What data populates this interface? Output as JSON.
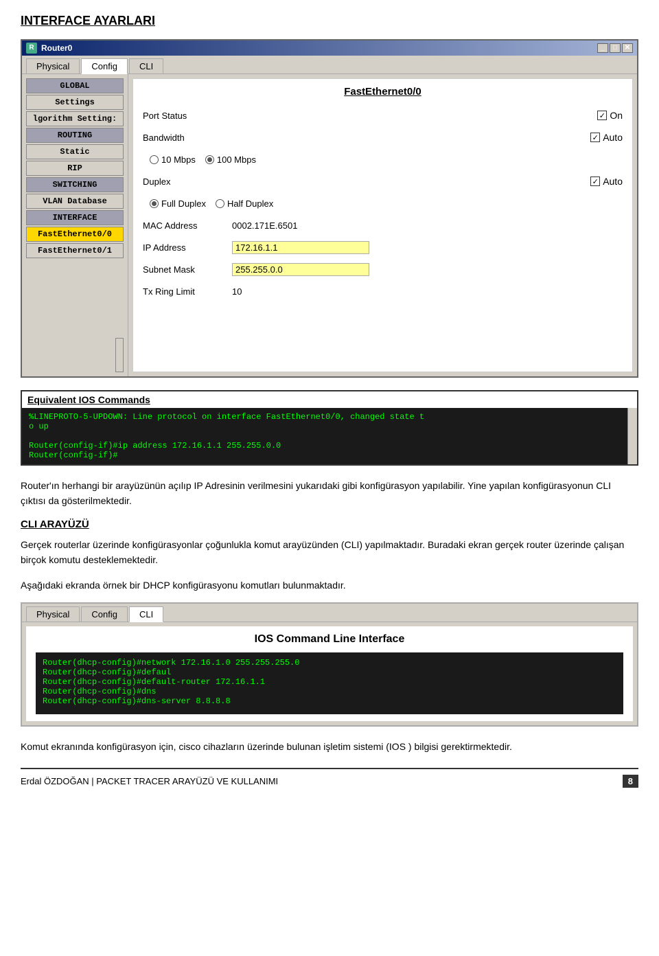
{
  "page": {
    "heading": "INTERFACE AYARLARI"
  },
  "router_window": {
    "title": "Router0",
    "tabs": [
      "Physical",
      "Config",
      "CLI"
    ],
    "active_tab": "Config",
    "sidebar": {
      "items": [
        {
          "label": "GLOBAL",
          "type": "section-header"
        },
        {
          "label": "Settings",
          "type": "normal"
        },
        {
          "label": "lgorithm Setting:",
          "type": "normal"
        },
        {
          "label": "ROUTING",
          "type": "section-header"
        },
        {
          "label": "Static",
          "type": "normal"
        },
        {
          "label": "RIP",
          "type": "normal"
        },
        {
          "label": "SWITCHING",
          "type": "section-header"
        },
        {
          "label": "VLAN Database",
          "type": "normal"
        },
        {
          "label": "INTERFACE",
          "type": "section-header"
        },
        {
          "label": "FastEthernet0/0",
          "type": "highlighted"
        },
        {
          "label": "FastEthernet0/1",
          "type": "normal"
        }
      ]
    },
    "content": {
      "title": "FastEthernet0/0",
      "port_status_label": "Port Status",
      "port_status_checked": true,
      "port_status_value": "On",
      "bandwidth_label": "Bandwidth",
      "bandwidth_auto": true,
      "bandwidth_auto_label": "Auto",
      "bandwidth_10": "10 Mbps",
      "bandwidth_100": "100 Mbps",
      "bandwidth_100_selected": true,
      "duplex_label": "Duplex",
      "duplex_auto": true,
      "duplex_auto_label": "Auto",
      "duplex_full": "Full Duplex",
      "duplex_half": "Half Duplex",
      "duplex_full_selected": true,
      "mac_label": "MAC Address",
      "mac_value": "0002.171E.6501",
      "ip_label": "IP Address",
      "ip_value": "172.16.1.1",
      "subnet_label": "Subnet Mask",
      "subnet_value": "255.255.0.0",
      "tx_label": "Tx Ring Limit",
      "tx_value": "10"
    }
  },
  "ios_commands": {
    "title": "Equivalent IOS Commands",
    "lines": [
      "%LINEPROTO-5-UPDOWN: Line protocol on interface FastEthernet0/0, changed state t",
      "o up",
      "",
      "Router(config-if)#ip address 172.16.1.1 255.255.0.0",
      "Router(config-if)#"
    ]
  },
  "body_texts": [
    "Router'ın herhangi bir arayüzünün açılıp IP Adresinin verilmesini yukarıdaki gibi konfigürasyon yapılabilir. Yine yapılan konfigürasyonun CLI çıktısı da gösterilmektedir.",
    "CLI ARAYÜZÜ",
    "Gerçek routerlar üzerinde konfigürasyonlar çoğunlukla komut arayüzünden (CLI)  yapılmaktadır. Buradaki ekran gerçek router üzerinde çalışan birçok komutu desteklemektedir.",
    "Aşağıdaki ekranda örnek  bir DHCP konfigürasyonu komutları bulunmaktadır."
  ],
  "cli_window": {
    "tabs": [
      "Physical",
      "Config",
      "CLI"
    ],
    "active_tab": "CLI",
    "title": "IOS Command Line Interface",
    "terminal_lines": [
      "Router(dhcp-config)#network 172.16.1.0 255.255.255.0",
      "Router(dhcp-config)#defaul",
      "Router(dhcp-config)#default-router 172.16.1.1",
      "Router(dhcp-config)#dns",
      "Router(dhcp-config)#dns-server 8.8.8.8"
    ]
  },
  "closing_text": "Komut ekranında konfigürasyon için, cisco cihazların üzerinde bulunan işletim sistemi (IOS ) bilgisi gerektirmektedir.",
  "footer": {
    "author": "Erdal ÖZDOĞAN | PACKET TRACER ARAYÜZÜ VE KULLANIMI",
    "page": "8"
  }
}
